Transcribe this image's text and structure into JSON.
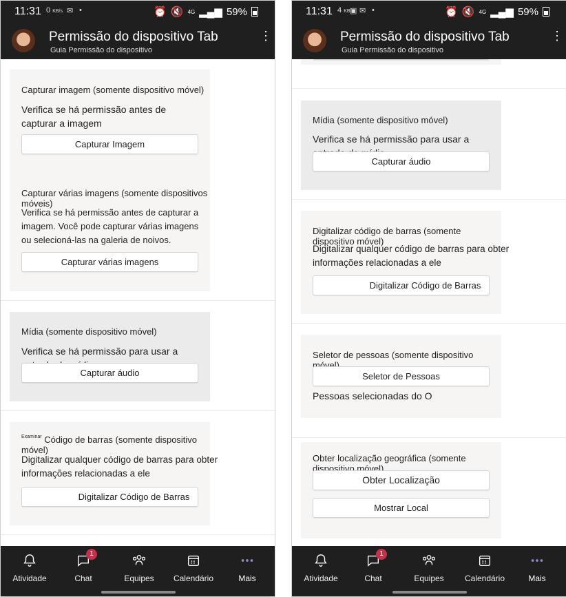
{
  "status": {
    "time": "11:31",
    "net_left": "0",
    "net_right": "4",
    "net_unit": "KB/s",
    "network": "4G",
    "battery": "59%"
  },
  "header": {
    "title": "Permissão do dispositivo Tab",
    "subtitle": "Guia Permissão do dispositivo"
  },
  "left": {
    "capture_image": {
      "label": "Capturar imagem (somente dispositivo móvel)",
      "desc": "Verifica se há permissão antes de capturar a imagem",
      "button": "Capturar Imagem"
    },
    "capture_multi": {
      "label": "Capturar várias imagens (somente dispositivos móveis)",
      "desc": "Verifica se há permissão antes de capturar a imagem. Você pode capturar várias imagens ou selecioná-las na galeria de noivos.",
      "button": "Capturar várias imagens"
    },
    "media": {
      "label": "Mídia (somente dispositivo móvel)",
      "desc": "Verifica se há permissão para usar a entrada de mídia",
      "button": "Capturar áudio"
    },
    "barcode": {
      "prefix": "Examinar",
      "label": "Código de barras (somente dispositivo móvel)",
      "desc": "Digitalizar qualquer código de barras para obter informações relacionadas a ele",
      "button": "Digitalizar Código de Barras"
    }
  },
  "right": {
    "media": {
      "label": "Mídia (somente dispositivo móvel)",
      "desc": "Verifica se há permissão para usar a entrada de mídia",
      "button": "Capturar áudio"
    },
    "barcode": {
      "label": "Digitalizar código de barras (somente dispositivo móvel)",
      "desc": "Digitalizar qualquer código de barras para obter informações relacionadas a ele",
      "button": "Digitalizar Código de Barras"
    },
    "people": {
      "label": "Seletor de pessoas (somente dispositivo móvel)",
      "button": "Seletor de Pessoas",
      "result": "Pessoas selecionadas do O"
    },
    "location": {
      "label": "Obter localização geográfica (somente dispositivo móvel)",
      "button_get": "Obter Localização",
      "button_show": "Mostrar Local"
    }
  },
  "tabs": [
    {
      "label": "Atividade",
      "icon": "bell-icon"
    },
    {
      "label": "Chat",
      "icon": "chat-icon",
      "badge": "1"
    },
    {
      "label": "Equipes",
      "icon": "teams-icon"
    },
    {
      "label": "Calendário",
      "icon": "calendar-icon"
    },
    {
      "label": "Mais",
      "icon": "more-icon"
    }
  ]
}
